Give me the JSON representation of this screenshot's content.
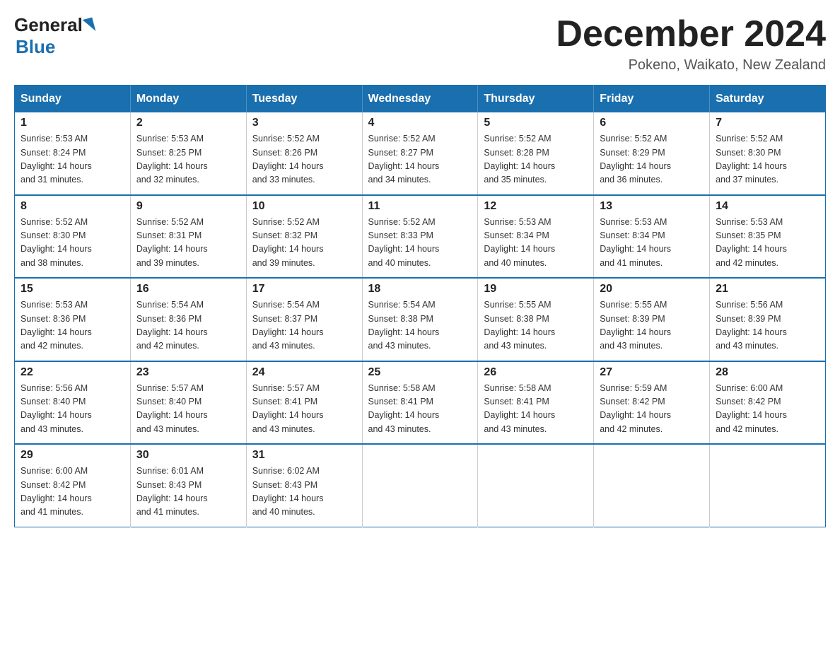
{
  "logo": {
    "general": "General",
    "blue": "Blue"
  },
  "header": {
    "title": "December 2024",
    "location": "Pokeno, Waikato, New Zealand"
  },
  "days_of_week": [
    "Sunday",
    "Monday",
    "Tuesday",
    "Wednesday",
    "Thursday",
    "Friday",
    "Saturday"
  ],
  "weeks": [
    [
      {
        "day": "1",
        "sunrise": "5:53 AM",
        "sunset": "8:24 PM",
        "daylight": "14 hours and 31 minutes."
      },
      {
        "day": "2",
        "sunrise": "5:53 AM",
        "sunset": "8:25 PM",
        "daylight": "14 hours and 32 minutes."
      },
      {
        "day": "3",
        "sunrise": "5:52 AM",
        "sunset": "8:26 PM",
        "daylight": "14 hours and 33 minutes."
      },
      {
        "day": "4",
        "sunrise": "5:52 AM",
        "sunset": "8:27 PM",
        "daylight": "14 hours and 34 minutes."
      },
      {
        "day": "5",
        "sunrise": "5:52 AM",
        "sunset": "8:28 PM",
        "daylight": "14 hours and 35 minutes."
      },
      {
        "day": "6",
        "sunrise": "5:52 AM",
        "sunset": "8:29 PM",
        "daylight": "14 hours and 36 minutes."
      },
      {
        "day": "7",
        "sunrise": "5:52 AM",
        "sunset": "8:30 PM",
        "daylight": "14 hours and 37 minutes."
      }
    ],
    [
      {
        "day": "8",
        "sunrise": "5:52 AM",
        "sunset": "8:30 PM",
        "daylight": "14 hours and 38 minutes."
      },
      {
        "day": "9",
        "sunrise": "5:52 AM",
        "sunset": "8:31 PM",
        "daylight": "14 hours and 39 minutes."
      },
      {
        "day": "10",
        "sunrise": "5:52 AM",
        "sunset": "8:32 PM",
        "daylight": "14 hours and 39 minutes."
      },
      {
        "day": "11",
        "sunrise": "5:52 AM",
        "sunset": "8:33 PM",
        "daylight": "14 hours and 40 minutes."
      },
      {
        "day": "12",
        "sunrise": "5:53 AM",
        "sunset": "8:34 PM",
        "daylight": "14 hours and 40 minutes."
      },
      {
        "day": "13",
        "sunrise": "5:53 AM",
        "sunset": "8:34 PM",
        "daylight": "14 hours and 41 minutes."
      },
      {
        "day": "14",
        "sunrise": "5:53 AM",
        "sunset": "8:35 PM",
        "daylight": "14 hours and 42 minutes."
      }
    ],
    [
      {
        "day": "15",
        "sunrise": "5:53 AM",
        "sunset": "8:36 PM",
        "daylight": "14 hours and 42 minutes."
      },
      {
        "day": "16",
        "sunrise": "5:54 AM",
        "sunset": "8:36 PM",
        "daylight": "14 hours and 42 minutes."
      },
      {
        "day": "17",
        "sunrise": "5:54 AM",
        "sunset": "8:37 PM",
        "daylight": "14 hours and 43 minutes."
      },
      {
        "day": "18",
        "sunrise": "5:54 AM",
        "sunset": "8:38 PM",
        "daylight": "14 hours and 43 minutes."
      },
      {
        "day": "19",
        "sunrise": "5:55 AM",
        "sunset": "8:38 PM",
        "daylight": "14 hours and 43 minutes."
      },
      {
        "day": "20",
        "sunrise": "5:55 AM",
        "sunset": "8:39 PM",
        "daylight": "14 hours and 43 minutes."
      },
      {
        "day": "21",
        "sunrise": "5:56 AM",
        "sunset": "8:39 PM",
        "daylight": "14 hours and 43 minutes."
      }
    ],
    [
      {
        "day": "22",
        "sunrise": "5:56 AM",
        "sunset": "8:40 PM",
        "daylight": "14 hours and 43 minutes."
      },
      {
        "day": "23",
        "sunrise": "5:57 AM",
        "sunset": "8:40 PM",
        "daylight": "14 hours and 43 minutes."
      },
      {
        "day": "24",
        "sunrise": "5:57 AM",
        "sunset": "8:41 PM",
        "daylight": "14 hours and 43 minutes."
      },
      {
        "day": "25",
        "sunrise": "5:58 AM",
        "sunset": "8:41 PM",
        "daylight": "14 hours and 43 minutes."
      },
      {
        "day": "26",
        "sunrise": "5:58 AM",
        "sunset": "8:41 PM",
        "daylight": "14 hours and 43 minutes."
      },
      {
        "day": "27",
        "sunrise": "5:59 AM",
        "sunset": "8:42 PM",
        "daylight": "14 hours and 42 minutes."
      },
      {
        "day": "28",
        "sunrise": "6:00 AM",
        "sunset": "8:42 PM",
        "daylight": "14 hours and 42 minutes."
      }
    ],
    [
      {
        "day": "29",
        "sunrise": "6:00 AM",
        "sunset": "8:42 PM",
        "daylight": "14 hours and 41 minutes."
      },
      {
        "day": "30",
        "sunrise": "6:01 AM",
        "sunset": "8:43 PM",
        "daylight": "14 hours and 41 minutes."
      },
      {
        "day": "31",
        "sunrise": "6:02 AM",
        "sunset": "8:43 PM",
        "daylight": "14 hours and 40 minutes."
      },
      null,
      null,
      null,
      null
    ]
  ],
  "labels": {
    "sunrise": "Sunrise:",
    "sunset": "Sunset:",
    "daylight": "Daylight:"
  }
}
